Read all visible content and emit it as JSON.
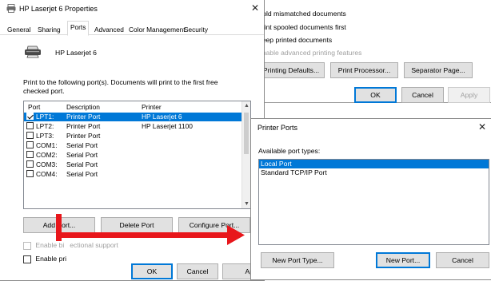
{
  "properties_window": {
    "title": "HP Laserjet 6 Properties",
    "tabs": [
      "General",
      "Sharing",
      "Ports",
      "Advanced",
      "Color Management",
      "Security"
    ],
    "active_tab": "Ports",
    "printer_name": "HP Laserjet 6",
    "instructions": "Print to the following port(s). Documents will print to the first free checked port.",
    "columns": [
      "Port",
      "Description",
      "Printer"
    ],
    "ports": [
      {
        "port": "LPT1:",
        "description": "Printer Port",
        "printer": "HP Laserjet 6",
        "checked": true,
        "selected": true
      },
      {
        "port": "LPT2:",
        "description": "Printer Port",
        "printer": "HP Laserjet  1100",
        "checked": false,
        "selected": false
      },
      {
        "port": "LPT3:",
        "description": "Printer Port",
        "printer": "",
        "checked": false,
        "selected": false
      },
      {
        "port": "COM1:",
        "description": "Serial Port",
        "printer": "",
        "checked": false,
        "selected": false
      },
      {
        "port": "COM2:",
        "description": "Serial Port",
        "printer": "",
        "checked": false,
        "selected": false
      },
      {
        "port": "COM3:",
        "description": "Serial Port",
        "printer": "",
        "checked": false,
        "selected": false
      },
      {
        "port": "COM4:",
        "description": "Serial Port",
        "printer": "",
        "checked": false,
        "selected": false
      }
    ],
    "add_port_label": "Add Port...",
    "delete_port_label": "Delete Port",
    "configure_port_label": "Configure Port...",
    "bidirectional_label": "Enable bidirectional support",
    "pooling_label": "Enable printer pooling",
    "pooling_visible": "Enable pri",
    "pooling_tail": "g",
    "bidirectional_visible_a": "Enable bi",
    "bidirectional_visible_b": "ectional support",
    "ok_label": "OK",
    "cancel_label": "Cancel",
    "apply_label": "Apply",
    "apply_visible": "Apply"
  },
  "advanced_window": {
    "options": [
      {
        "label": "Hold mismatched documents",
        "visible": "Hold mismatched documents",
        "disabled": false
      },
      {
        "label": "Print spooled documents first",
        "visible": "Print spooled documents first",
        "disabled": false
      },
      {
        "label": "Keep printed documents",
        "visible": "Keep printed documents",
        "disabled": false
      },
      {
        "label": "Enable advanced printing features",
        "visible": "Enable advanced printing features",
        "disabled": true
      }
    ],
    "printing_defaults_label": "Printing Defaults...",
    "print_processor_label": "Print Processor...",
    "separator_page_label": "Separator Page...",
    "ok_label": "OK",
    "cancel_label": "Cancel",
    "apply_label": "Apply"
  },
  "ports_dialog": {
    "title": "Printer Ports",
    "available_label": "Available port types:",
    "port_types": [
      {
        "label": "Local Port",
        "selected": true
      },
      {
        "label": "Standard TCP/IP Port",
        "selected": false
      }
    ],
    "new_port_type_label": "New Port Type...",
    "new_port_label": "New Port...",
    "cancel_label": "Cancel"
  },
  "colors": {
    "selection": "#0078d7",
    "arrow": "#e8161b"
  },
  "icons": {
    "title_printer": "printer-icon",
    "header_printer": "printer-large-icon",
    "close": "close-icon"
  }
}
